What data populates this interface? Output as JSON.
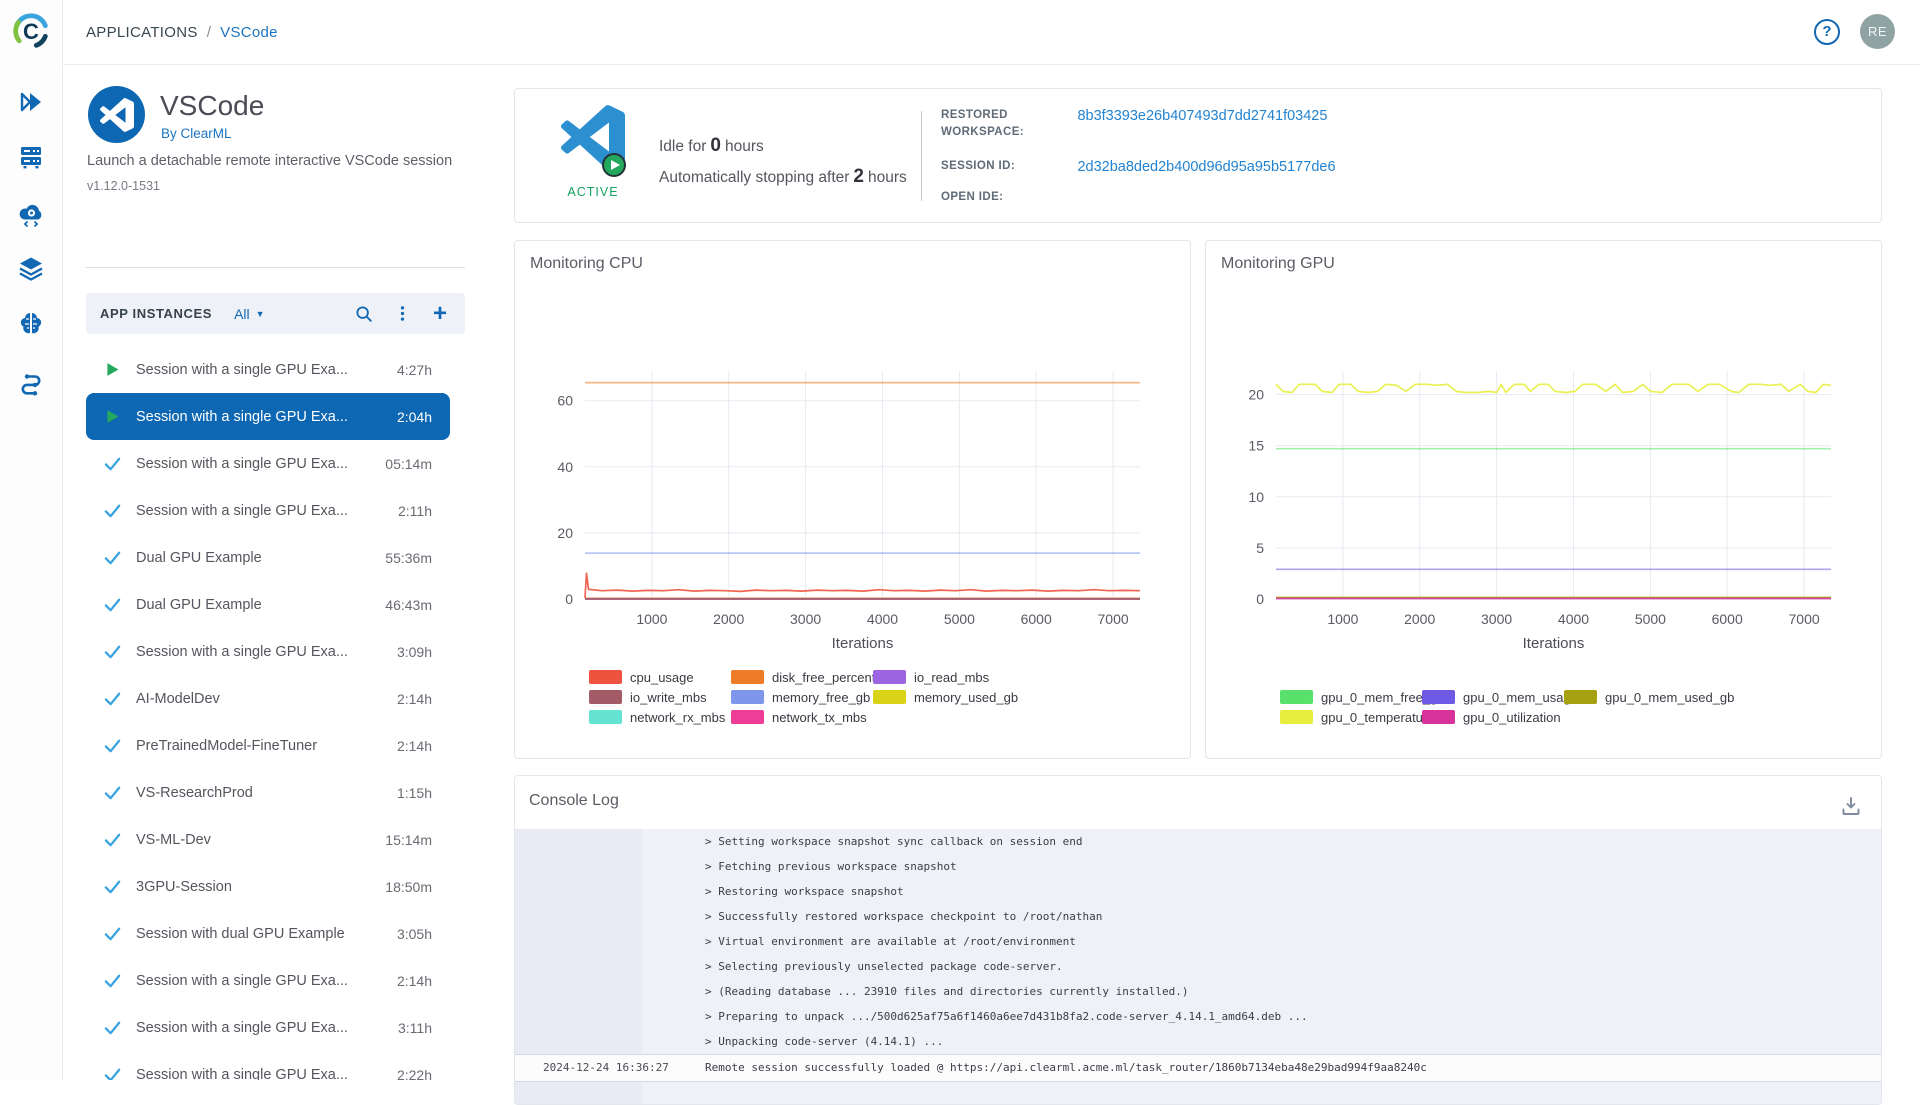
{
  "topbar": {
    "breadcrumb": {
      "section": "APPLICATIONS",
      "separator": "/",
      "current": "VSCode"
    },
    "help_label": "?",
    "avatar": "RE"
  },
  "sidebar": {
    "items": [
      {
        "icon": "applications-icon"
      },
      {
        "icon": "workers-icon"
      },
      {
        "icon": "autoscaler-icon"
      },
      {
        "icon": "datasets-icon"
      },
      {
        "icon": "models-icon"
      },
      {
        "icon": "pipelines-icon"
      }
    ]
  },
  "app_header": {
    "title": "VSCode",
    "byline": "By ClearML",
    "description": "Launch a detachable remote interactive VSCode session",
    "version": "v1.12.0-1531"
  },
  "instances": {
    "title": "APP INSTANCES",
    "filter_label": "All",
    "items": [
      {
        "name": "Session with a single GPU Exa...",
        "duration": "4:27h",
        "status": "running",
        "selected": false
      },
      {
        "name": "Session with a single GPU Exa...",
        "duration": "2:04h",
        "status": "running",
        "selected": true
      },
      {
        "name": "Session with a single GPU Exa...",
        "duration": "05:14m",
        "status": "completed",
        "selected": false
      },
      {
        "name": "Session with a single GPU Exa...",
        "duration": "2:11h",
        "status": "completed",
        "selected": false
      },
      {
        "name": "Dual GPU Example",
        "duration": "55:36m",
        "status": "completed",
        "selected": false
      },
      {
        "name": "Dual GPU Example",
        "duration": "46:43m",
        "status": "completed",
        "selected": false
      },
      {
        "name": "Session with a single GPU Exa...",
        "duration": "3:09h",
        "status": "completed",
        "selected": false
      },
      {
        "name": "AI-ModelDev",
        "duration": "2:14h",
        "status": "completed",
        "selected": false
      },
      {
        "name": "PreTrainedModel-FineTuner",
        "duration": "2:14h",
        "status": "completed",
        "selected": false
      },
      {
        "name": "VS-ResearchProd",
        "duration": "1:15h",
        "status": "completed",
        "selected": false
      },
      {
        "name": "VS-ML-Dev",
        "duration": "15:14m",
        "status": "completed",
        "selected": false
      },
      {
        "name": "3GPU-Session",
        "duration": "18:50m",
        "status": "completed",
        "selected": false
      },
      {
        "name": "Session with dual GPU Example",
        "duration": "3:05h",
        "status": "completed",
        "selected": false
      },
      {
        "name": "Session with a single GPU Exa...",
        "duration": "2:14h",
        "status": "completed",
        "selected": false
      },
      {
        "name": "Session with a single GPU Exa...",
        "duration": "3:11h",
        "status": "completed",
        "selected": false
      },
      {
        "name": "Session with a single GPU Exa...",
        "duration": "2:22h",
        "status": "completed",
        "selected": false
      }
    ]
  },
  "status_card": {
    "badge": "ACTIVE",
    "idle": {
      "prefix": "Idle for",
      "value": "0",
      "suffix": "hours"
    },
    "autostop": {
      "prefix": "Automatically stopping after",
      "value": "2",
      "suffix": "hours"
    },
    "fields": [
      {
        "label": "RESTORED WORKSPACE:",
        "value": "8b3f3393e26b407493d7dd2741f03425"
      },
      {
        "label": "SESSION ID:",
        "value": "2d32ba8ded2b400d96d95a95b5177de6"
      },
      {
        "label": "OPEN IDE:",
        "value": ""
      }
    ]
  },
  "chart_data": [
    {
      "type": "line",
      "title": "Monitoring CPU",
      "xlabel": "Iterations",
      "ylabel": "",
      "xlim": [
        130,
        7350
      ],
      "ylim": [
        0,
        69
      ],
      "x_ticks": [
        1000,
        2000,
        3000,
        4000,
        5000,
        6000,
        7000
      ],
      "y_ticks": [
        0,
        20,
        40,
        60
      ],
      "grid": true,
      "legend_position": "bottom",
      "series": [
        {
          "name": "io_read_mbs",
          "color": "#9c64e0",
          "points": [
            [
              130,
              0.05
            ],
            [
              7350,
              0.05
            ]
          ]
        },
        {
          "name": "network_rx_mbs",
          "color": "#64e3d3",
          "points": [
            [
              130,
              0
            ],
            [
              7350,
              0
            ]
          ]
        },
        {
          "name": "memory_used_gb",
          "color": "#d9d217",
          "points": [
            [
              130,
              0.2
            ],
            [
              7350,
              0.2
            ]
          ]
        },
        {
          "name": "network_tx_mbs",
          "color": "#ee3d97",
          "points": [
            [
              130,
              0.12
            ],
            [
              7350,
              0.12
            ]
          ]
        },
        {
          "name": "io_write_mbs",
          "color": "#a35b68",
          "points": [
            [
              130,
              0
            ],
            [
              7350,
              0
            ]
          ]
        },
        {
          "name": "memory_free_gb",
          "color": "#7e97ec",
          "points": [
            [
              130,
              13.9
            ],
            [
              7350,
              13.9
            ]
          ]
        },
        {
          "name": "disk_free_percent",
          "color": "#ee7b28",
          "points": [
            [
              130,
              65.5
            ],
            [
              7350,
              65.5
            ]
          ]
        },
        {
          "name": "cpu_usage",
          "color": "#ee5340",
          "points": [
            [
              130,
              0.3
            ],
            [
              150,
              7.8
            ],
            [
              175,
              2.9
            ],
            [
              350,
              2.5
            ],
            [
              550,
              2.7
            ],
            [
              750,
              2.4
            ],
            [
              950,
              2.6
            ],
            [
              1150,
              2.5
            ],
            [
              1350,
              2.8
            ],
            [
              1550,
              2.4
            ],
            [
              1750,
              2.6
            ],
            [
              1950,
              2.5
            ],
            [
              2150,
              2.3
            ],
            [
              2350,
              2.7
            ],
            [
              2550,
              2.5
            ],
            [
              2750,
              2.6
            ],
            [
              2950,
              2.4
            ],
            [
              3150,
              2.7
            ],
            [
              3350,
              2.5
            ],
            [
              3550,
              2.6
            ],
            [
              3750,
              2.4
            ],
            [
              3950,
              2.8
            ],
            [
              4150,
              2.5
            ],
            [
              4350,
              2.6
            ],
            [
              4550,
              2.4
            ],
            [
              4750,
              2.7
            ],
            [
              4950,
              2.5
            ],
            [
              5150,
              2.8
            ],
            [
              5350,
              2.4
            ],
            [
              5550,
              2.6
            ],
            [
              5750,
              2.5
            ],
            [
              5950,
              2.7
            ],
            [
              6150,
              2.4
            ],
            [
              6350,
              2.6
            ],
            [
              6550,
              2.5
            ],
            [
              6750,
              2.8
            ],
            [
              6950,
              2.5
            ],
            [
              7150,
              2.6
            ],
            [
              7350,
              2.5
            ]
          ]
        }
      ],
      "legend_rows": [
        [
          "cpu_usage",
          "disk_free_percent",
          "io_read_mbs"
        ],
        [
          "io_write_mbs",
          "memory_free_gb",
          "memory_used_gb"
        ],
        [
          "network_rx_mbs",
          "network_tx_mbs"
        ]
      ]
    },
    {
      "type": "line",
      "title": "Monitoring GPU",
      "xlabel": "Iterations",
      "ylabel": "",
      "xlim": [
        130,
        7350
      ],
      "ylim": [
        0,
        22.3
      ],
      "x_ticks": [
        1000,
        2000,
        3000,
        4000,
        5000,
        6000,
        7000
      ],
      "y_ticks": [
        0,
        5,
        10,
        15,
        20
      ],
      "grid": true,
      "legend_position": "bottom",
      "series": [
        {
          "name": "gpu_0_mem_used_gb",
          "color": "#a6a111",
          "points": [
            [
              130,
              0.15
            ],
            [
              7350,
              0.15
            ]
          ]
        },
        {
          "name": "gpu_0_utilization",
          "color": "#d6329a",
          "points": [
            [
              130,
              0.05
            ],
            [
              7350,
              0.05
            ]
          ]
        },
        {
          "name": "gpu_0_mem_usage",
          "color": "#6e5ae5",
          "points": [
            [
              130,
              2.9
            ],
            [
              7350,
              2.9
            ]
          ]
        },
        {
          "name": "gpu_0_mem_free_gb",
          "color": "#58e26c",
          "points": [
            [
              130,
              14.7
            ],
            [
              7350,
              14.7
            ]
          ]
        },
        {
          "name": "gpu_0_temperature",
          "color": "#e7ee3d",
          "points": [
            [
              130,
              21
            ],
            [
              220,
              20.3
            ],
            [
              340,
              20.2
            ],
            [
              430,
              21
            ],
            [
              640,
              21
            ],
            [
              730,
              20.3
            ],
            [
              860,
              20.2
            ],
            [
              950,
              21
            ],
            [
              1100,
              21
            ],
            [
              1200,
              20.3
            ],
            [
              1330,
              20.2
            ],
            [
              1450,
              20.3
            ],
            [
              1560,
              21
            ],
            [
              1700,
              20.9
            ],
            [
              1820,
              20.3
            ],
            [
              1940,
              21
            ],
            [
              2100,
              21
            ],
            [
              2230,
              20.9
            ],
            [
              2360,
              21
            ],
            [
              2480,
              20.3
            ],
            [
              2600,
              20.2
            ],
            [
              2750,
              20.2
            ],
            [
              2900,
              20.3
            ],
            [
              3000,
              20.2
            ],
            [
              3060,
              21
            ],
            [
              3120,
              20.2
            ],
            [
              3230,
              21
            ],
            [
              3360,
              21
            ],
            [
              3440,
              20.3
            ],
            [
              3550,
              21
            ],
            [
              3670,
              21
            ],
            [
              3760,
              20.3
            ],
            [
              3900,
              20.2
            ],
            [
              4020,
              20.3
            ],
            [
              4120,
              21
            ],
            [
              4290,
              21
            ],
            [
              4420,
              20.3
            ],
            [
              4540,
              21
            ],
            [
              4640,
              20.2
            ],
            [
              4780,
              20.3
            ],
            [
              4900,
              21
            ],
            [
              5000,
              20.3
            ],
            [
              5150,
              20.2
            ],
            [
              5280,
              21
            ],
            [
              5500,
              21
            ],
            [
              5620,
              20.3
            ],
            [
              5750,
              21
            ],
            [
              5900,
              21
            ],
            [
              6050,
              20.3
            ],
            [
              6150,
              20.2
            ],
            [
              6280,
              21
            ],
            [
              6430,
              21
            ],
            [
              6550,
              20.9
            ],
            [
              6700,
              21
            ],
            [
              6800,
              20.3
            ],
            [
              6950,
              21
            ],
            [
              7050,
              20.3
            ],
            [
              7150,
              20.2
            ],
            [
              7250,
              21
            ],
            [
              7350,
              20.9
            ]
          ]
        }
      ],
      "legend_rows": [
        [
          "gpu_0_mem_free_gb",
          "gpu_0_mem_usage",
          "gpu_0_mem_used_gb"
        ],
        [
          "gpu_0_temperature",
          "gpu_0_utilization"
        ]
      ]
    }
  ],
  "console": {
    "title": "Console Log",
    "lines": [
      "> Setting workspace snapshot sync callback on session end",
      "> Fetching previous workspace snapshot",
      "> Restoring workspace snapshot",
      "> Successfully restored workspace checkpoint to /root/nathan",
      "> Virtual environment are available at /root/environment",
      "> Selecting previously unselected package code-server.",
      "> (Reading database ... 23910 files and directories currently installed.)",
      "> Preparing to unpack .../500d625af75a6f1460a6ee7d431b8fa2.code-server_4.14.1_amd64.deb ...",
      "> Unpacking code-server (4.14.1) ..."
    ],
    "highlight_row": {
      "timestamp": "2024-12-24 16:36:27",
      "message": "Remote session successfully loaded @ https://api.clearml.acme.ml/task_router/1860b7134eba48e29bad994f9aa8240c"
    }
  },
  "colors": {
    "accent_blue": "#0d67b2",
    "link_blue": "#1c73bf",
    "icon_blue": "#1268b3",
    "active_green": "#12a35f",
    "play_green": "#23a85e",
    "check_blue": "#38a3e0"
  }
}
